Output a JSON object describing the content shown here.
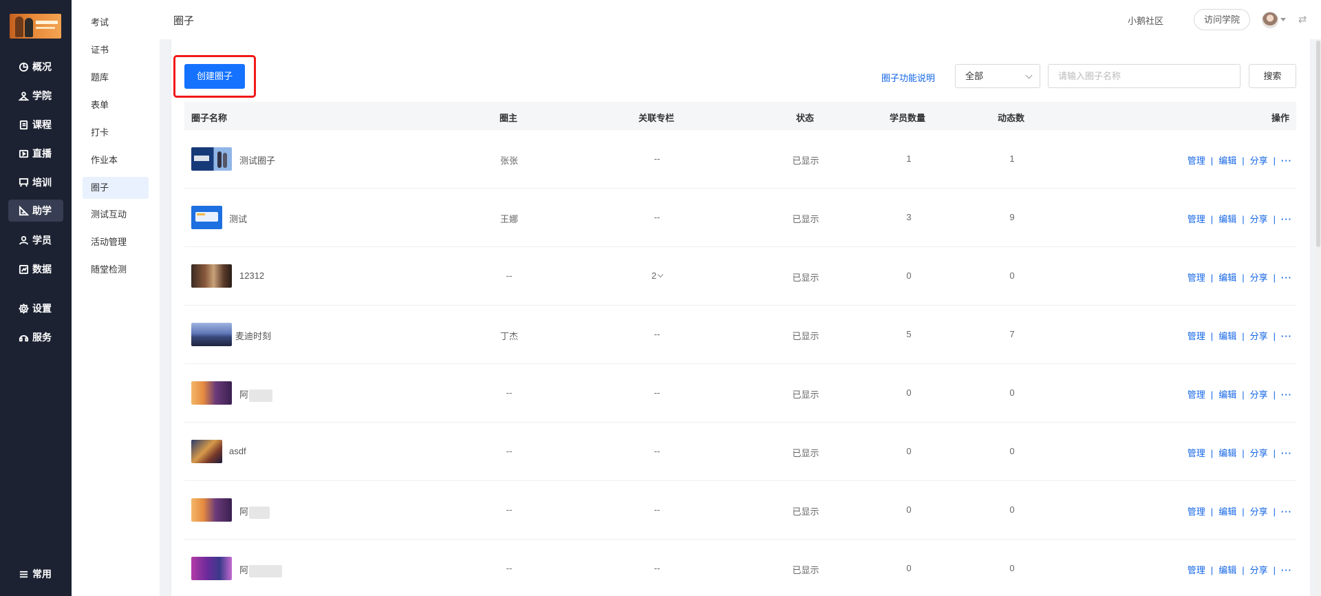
{
  "rail": {
    "items": [
      {
        "label": "概况",
        "icon": "pie-chart-icon"
      },
      {
        "label": "学院",
        "icon": "school-icon"
      },
      {
        "label": "课程",
        "icon": "book-icon"
      },
      {
        "label": "直播",
        "icon": "live-icon"
      },
      {
        "label": "培训",
        "icon": "training-board-icon"
      },
      {
        "label": "助学",
        "icon": "ruler-triangle-icon",
        "active": true
      },
      {
        "label": "学员",
        "icon": "user-icon"
      },
      {
        "label": "数据",
        "icon": "data-chart-icon"
      },
      {
        "label": "设置",
        "icon": "gear-icon"
      },
      {
        "label": "服务",
        "icon": "service-icon"
      }
    ],
    "bottom": {
      "label": "常用",
      "icon": "list-icon"
    }
  },
  "subnav": {
    "items": [
      {
        "label": "考试"
      },
      {
        "label": "证书"
      },
      {
        "label": "题库"
      },
      {
        "label": "表单"
      },
      {
        "label": "打卡"
      },
      {
        "label": "作业本"
      },
      {
        "label": "圈子",
        "active": true
      },
      {
        "label": "测试互动"
      },
      {
        "label": "活动管理"
      },
      {
        "label": "随堂检测"
      }
    ]
  },
  "header": {
    "title": "圈子",
    "community": "小鹅社区",
    "visit": "访问学院",
    "switch_icon": "⇄"
  },
  "toolbar": {
    "create_label": "创建圈子",
    "func_link": "圈子功能说明",
    "filter_value": "全部",
    "search_placeholder": "请输入圈子名称",
    "search_label": "搜索"
  },
  "table": {
    "columns": {
      "name": "圈子名称",
      "owner": "圈主",
      "column": "关联专栏",
      "status": "状态",
      "members": "学员数量",
      "posts": "动态数",
      "ops": "操作"
    },
    "ops": {
      "manage": "管理",
      "edit": "编辑",
      "share": "分享",
      "more": "···",
      "sep": "|"
    },
    "rows": [
      {
        "name": "测试圈子",
        "owner": "张张",
        "column": "--",
        "status": "已显示",
        "members": "1",
        "posts": "1"
      },
      {
        "name": "测试",
        "owner": "王娜",
        "column": "--",
        "status": "已显示",
        "members": "3",
        "posts": "9"
      },
      {
        "name": "12312",
        "owner": "--",
        "column": "2",
        "status": "已显示",
        "members": "0",
        "posts": "0"
      },
      {
        "name": "麦迪时刻",
        "owner": "丁杰",
        "column": "--",
        "status": "已显示",
        "members": "5",
        "posts": "7"
      },
      {
        "name": "阿",
        "owner": "--",
        "column": "--",
        "status": "已显示",
        "members": "0",
        "posts": "0"
      },
      {
        "name": "asdf",
        "owner": "--",
        "column": "--",
        "status": "已显示",
        "members": "0",
        "posts": "0"
      },
      {
        "name": "阿",
        "owner": "--",
        "column": "--",
        "status": "已显示",
        "members": "0",
        "posts": "0"
      },
      {
        "name": "阿",
        "owner": "--",
        "column": "--",
        "status": "已显示",
        "members": "0",
        "posts": "0"
      }
    ]
  },
  "colors": {
    "primary": "#1472ff",
    "link": "#1466e6",
    "rail_bg": "#1d2232",
    "highlight": "#f11818"
  }
}
